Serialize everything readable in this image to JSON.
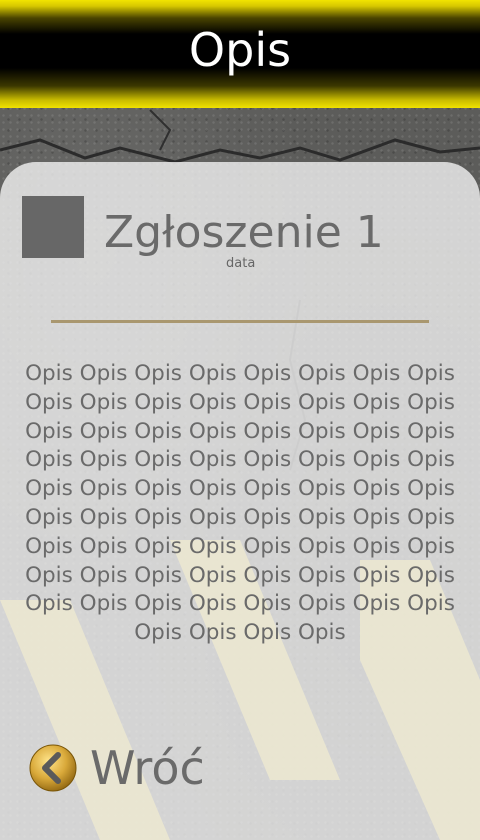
{
  "header": {
    "title": "Opis"
  },
  "report": {
    "title": "Zgłoszenie 1",
    "date": "data",
    "description": "Opis Opis Opis Opis Opis Opis Opis Opis Opis Opis Opis Opis Opis Opis Opis Opis Opis Opis Opis Opis Opis Opis Opis Opis Opis Opis Opis Opis Opis Opis Opis Opis Opis Opis Opis Opis Opis Opis Opis Opis Opis Opis Opis Opis Opis Opis Opis Opis Opis Opis Opis Opis Opis Opis Opis Opis Opis Opis Opis Opis Opis Opis Opis Opis Opis Opis Opis Opis Opis Opis Opis Opis Opis Opis Opis Opis"
  },
  "footer": {
    "back_label": "Wróć",
    "back_icon": "chevron-left-icon"
  },
  "colors": {
    "accent_yellow": "#f2e400",
    "divider": "#a9976f",
    "text_gray": "#6a6a6a"
  }
}
